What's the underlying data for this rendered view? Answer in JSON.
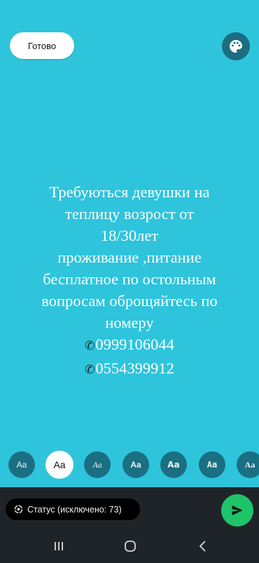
{
  "header": {
    "done_label": "Готово",
    "palette_icon": "palette-icon"
  },
  "status_text": {
    "lines": [
      "Требуються девушки на",
      "теплицу возрост от",
      "18/30лет",
      "проживание ,питание",
      "бесплатное по остольным",
      "вопросам оброщяйтесь по",
      "номеру"
    ],
    "phones": [
      "0999106044",
      "0554399912"
    ],
    "phone_icon": "telephone-receiver-icon",
    "text_color": "#ffffff"
  },
  "font_options": {
    "labels": [
      "Aa",
      "Aa",
      "Aa",
      "Aa",
      "Aa",
      "Aa",
      "Aa"
    ],
    "selected_index": 1
  },
  "bottom_bar": {
    "status_label": "Статус (исключено: 73)",
    "send_icon": "send-icon"
  },
  "nav": [
    "recent-apps-icon",
    "home-icon",
    "back-icon"
  ],
  "colors": {
    "background": "#2ec4dc",
    "send": "#1ec46a",
    "chip": "#1b6f82"
  }
}
